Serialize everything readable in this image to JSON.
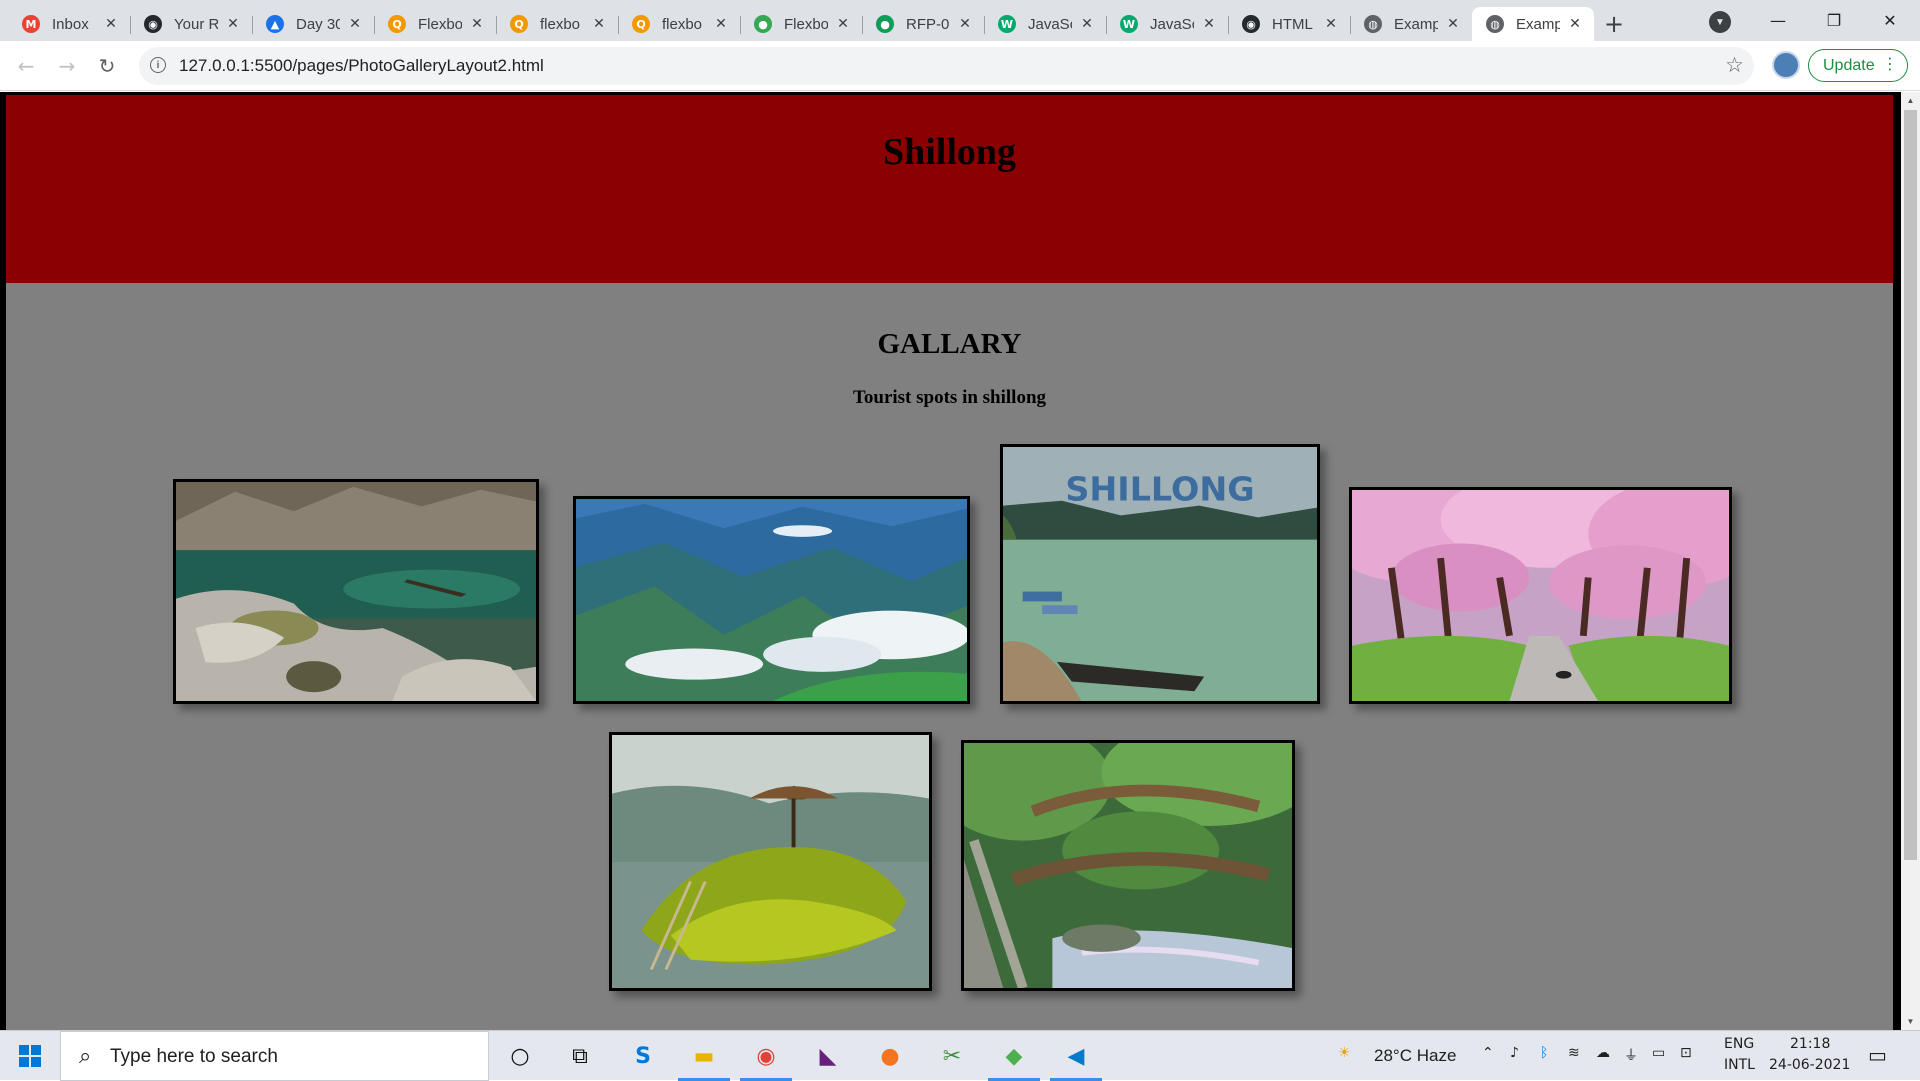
{
  "browser": {
    "tabs": [
      {
        "title": "Inbox",
        "icon": "gmail-icon",
        "color": "#ea4335",
        "glyph": "M",
        "active": false
      },
      {
        "title": "Your R",
        "icon": "github-icon",
        "color": "#24292e",
        "glyph": "◉",
        "active": false
      },
      {
        "title": "Day 30",
        "icon": "classroom-icon",
        "color": "#1a73e8",
        "glyph": "▲",
        "active": false
      },
      {
        "title": "Flexbo",
        "icon": "search-result-icon",
        "color": "#f29900",
        "glyph": "Q",
        "active": false
      },
      {
        "title": "flexbo",
        "icon": "search-result-icon",
        "color": "#f29900",
        "glyph": "Q",
        "active": false
      },
      {
        "title": "flexbo",
        "icon": "search-result-icon",
        "color": "#f29900",
        "glyph": "Q",
        "active": false
      },
      {
        "title": "Flexbo",
        "icon": "flexbox-froggy-icon",
        "color": "#34a853",
        "glyph": "●",
        "active": false
      },
      {
        "title": "RFP-0",
        "icon": "hangouts-icon",
        "color": "#0f9d58",
        "glyph": "●",
        "active": false
      },
      {
        "title": "JavaSc",
        "icon": "w3schools-icon",
        "color": "#04aa6d",
        "glyph": "W",
        "active": false
      },
      {
        "title": "JavaSc",
        "icon": "w3schools-icon",
        "color": "#04aa6d",
        "glyph": "W",
        "active": false
      },
      {
        "title": "HTML",
        "icon": "github-icon",
        "color": "#24292e",
        "glyph": "◉",
        "active": false
      },
      {
        "title": "Examp",
        "icon": "globe-icon",
        "color": "#5f6368",
        "glyph": "◍",
        "active": false
      },
      {
        "title": "Examp",
        "icon": "globe-icon",
        "color": "#5f6368",
        "glyph": "◍",
        "active": true
      }
    ],
    "url": "127.0.0.1:5500/pages/PhotoGalleryLayout2.html",
    "update_label": "Update"
  },
  "page": {
    "site_title": "Shillong",
    "gallery_title": "GALLARY",
    "gallery_subtitle": "Tourist spots in shillong",
    "photos": [
      {
        "name": "rocky-river-photo",
        "overlay_text": ""
      },
      {
        "name": "misty-mountains-photo",
        "overlay_text": ""
      },
      {
        "name": "lake-boat-photo",
        "overlay_text": "SHILLONG"
      },
      {
        "name": "cherry-blossom-road-photo",
        "overlay_text": ""
      },
      {
        "name": "mossy-island-hut-photo",
        "overlay_text": ""
      },
      {
        "name": "living-root-bridge-photo",
        "overlay_text": ""
      }
    ]
  },
  "taskbar": {
    "search_placeholder": "Type here to search",
    "weather": "28°C  Haze",
    "lang_top": "ENG",
    "lang_bottom": "INTL",
    "time": "21:18",
    "date": "24-06-2021"
  },
  "colors": {
    "header_bg": "#8b0000",
    "page_bg": "#808080",
    "accent_green": "#1e8e3e"
  }
}
